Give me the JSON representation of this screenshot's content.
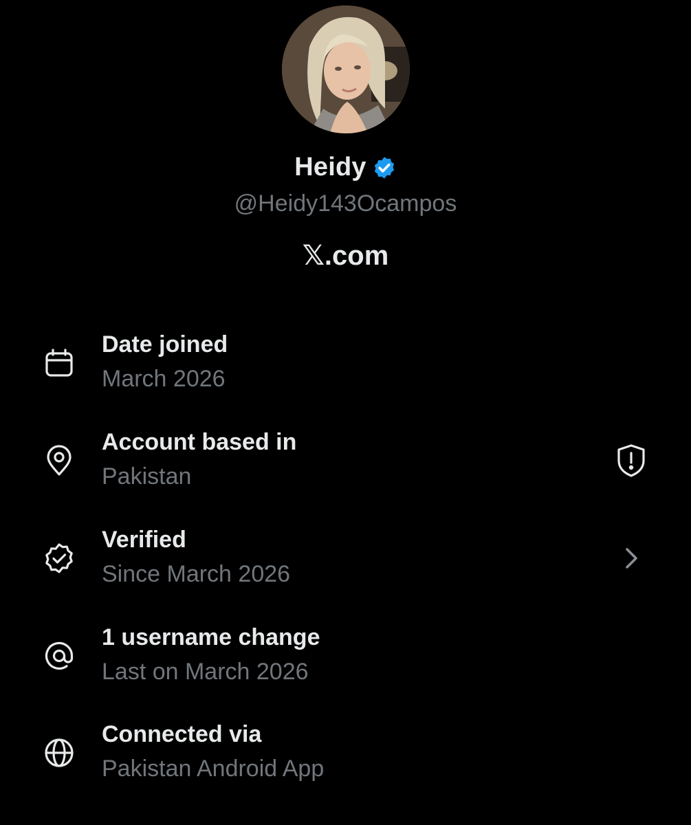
{
  "profile": {
    "display_name": "Heidy",
    "handle": "@Heidy143Ocampos",
    "platform": "𝕏.com"
  },
  "about_rows": [
    {
      "icon": "calendar-icon",
      "title": "Date joined",
      "subtitle": "March 2026"
    },
    {
      "icon": "location-pin-icon",
      "title": "Account based in",
      "subtitle": "Pakistan",
      "trailing_icon": "shield-alert-icon"
    },
    {
      "icon": "verified-outline-icon",
      "title": "Verified",
      "subtitle": "Since March 2026",
      "trailing_icon": "chevron-right-icon"
    },
    {
      "icon": "at-sign-icon",
      "title": "1 username change",
      "subtitle": "Last on March 2026"
    },
    {
      "icon": "globe-icon",
      "title": "Connected via",
      "subtitle": "Pakistan Android App"
    }
  ],
  "colors": {
    "background": "#000000",
    "primary_text": "#e7e9ea",
    "secondary_text": "#71767b",
    "verified_blue": "#1d9bf0"
  }
}
